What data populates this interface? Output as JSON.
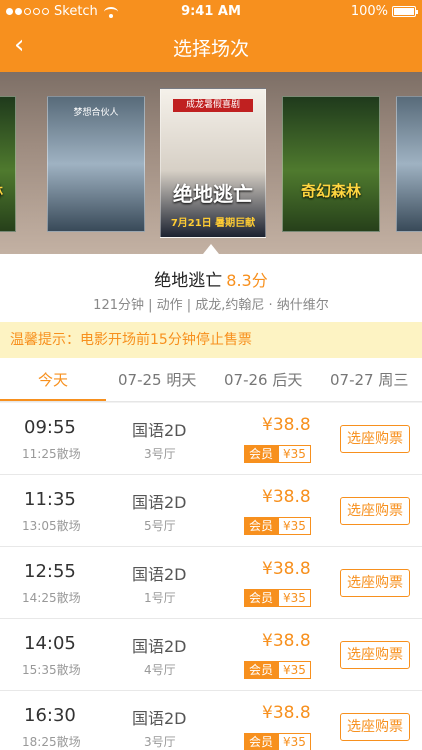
{
  "status_bar": {
    "carrier": "Sketch",
    "time": "9:41 AM",
    "battery": "100%"
  },
  "header": {
    "title": "选择场次"
  },
  "posters": [
    {
      "caption": "林"
    },
    {
      "caption": "梦想合伙人"
    },
    {
      "banner": "成龙暑假喜剧",
      "caption": "绝地逃亡",
      "date": "7月21日 暑期巨献"
    },
    {
      "caption": "奇幻森林"
    },
    {
      "caption": ""
    }
  ],
  "movie": {
    "name": "绝地逃亡",
    "score": "8.3分",
    "meta": "121分钟 | 动作 | 成龙,约翰尼 · 纳什维尔"
  },
  "notice": "温馨提示：电影开场前15分钟停止售票",
  "tabs": [
    {
      "label": "今天",
      "active": true
    },
    {
      "label": "07-25 明天"
    },
    {
      "label": "07-26 后天"
    },
    {
      "label": "07-27 周三"
    }
  ],
  "sessions": [
    {
      "start": "09:55",
      "end": "11:25散场",
      "language": "国语2D",
      "hall": "3号厅",
      "price": "¥38.8",
      "member_label": "会员",
      "member_price": "¥35",
      "buy": "选座购票"
    },
    {
      "start": "11:35",
      "end": "13:05散场",
      "language": "国语2D",
      "hall": "5号厅",
      "price": "¥38.8",
      "member_label": "会员",
      "member_price": "¥35",
      "buy": "选座购票"
    },
    {
      "start": "12:55",
      "end": "14:25散场",
      "language": "国语2D",
      "hall": "1号厅",
      "price": "¥38.8",
      "member_label": "会员",
      "member_price": "¥35",
      "buy": "选座购票"
    },
    {
      "start": "14:05",
      "end": "15:35散场",
      "language": "国语2D",
      "hall": "4号厅",
      "price": "¥38.8",
      "member_label": "会员",
      "member_price": "¥35",
      "buy": "选座购票"
    },
    {
      "start": "16:30",
      "end": "18:25散场",
      "language": "国语2D",
      "hall": "3号厅",
      "price": "¥38.8",
      "member_label": "会员",
      "member_price": "¥35",
      "buy": "选座购票"
    }
  ]
}
